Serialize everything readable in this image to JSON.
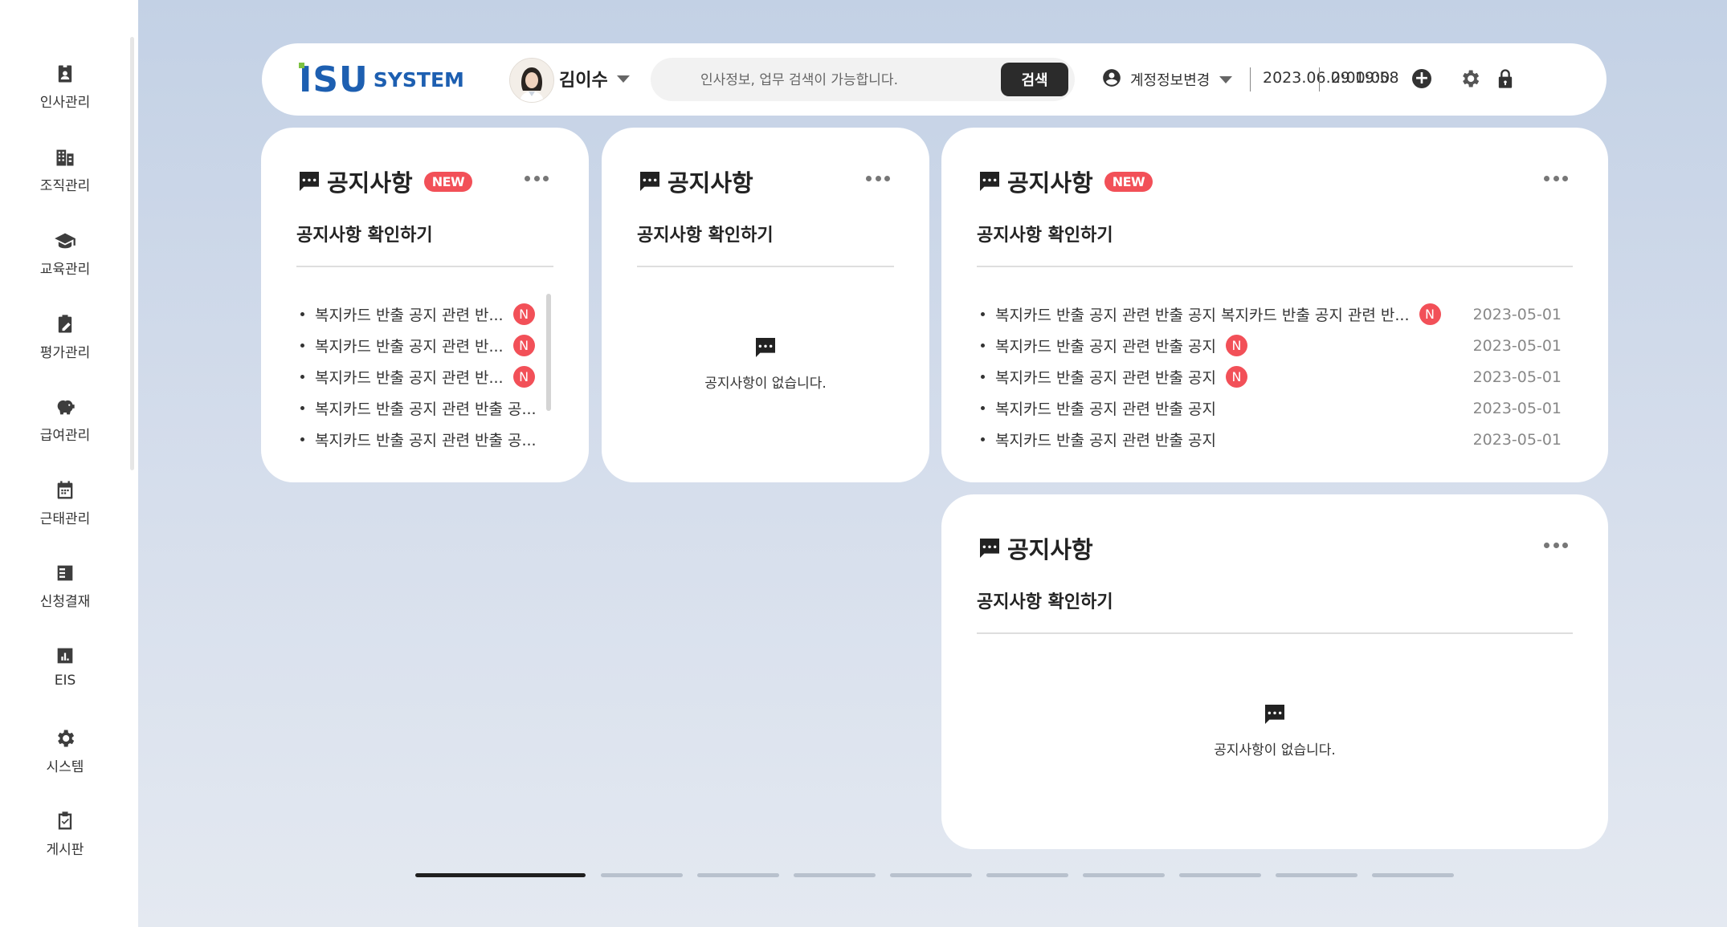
{
  "sidebar": {
    "items": [
      {
        "label": "인사관리",
        "icon": "badge-icon"
      },
      {
        "label": "조직관리",
        "icon": "building-icon"
      },
      {
        "label": "교육관리",
        "icon": "graduation-cap-icon"
      },
      {
        "label": "평가관리",
        "icon": "clipboard-edit-icon"
      },
      {
        "label": "급여관리",
        "icon": "piggy-bank-icon"
      },
      {
        "label": "근태관리",
        "icon": "calendar-icon"
      },
      {
        "label": "신청결재",
        "icon": "checklist-icon"
      },
      {
        "label": "EIS",
        "icon": "bar-chart-icon"
      },
      {
        "label": "시스템",
        "icon": "gear-icon"
      },
      {
        "label": "게시판",
        "icon": "clipboard-check-icon"
      }
    ]
  },
  "header": {
    "logo_mark": "ISU",
    "logo_text": "SYSTEM",
    "user_name": "김이수",
    "search_placeholder": "인사정보, 업무 검색이 가능합니다.",
    "search_button": "검색",
    "account_label": "계정정보변경",
    "datetime": "2023.06.09 19:58",
    "timer": "2:00:00",
    "timer_add": "+"
  },
  "cards": [
    {
      "title": "공지사항",
      "new_badge": "NEW",
      "subtitle": "공지사항 확인하기",
      "items": [
        {
          "text": "복지카드 반출 공지 관련 반...",
          "new": "N"
        },
        {
          "text": "복지카드 반출 공지 관련 반...",
          "new": "N"
        },
        {
          "text": "복지카드 반출 공지 관련 반...",
          "new": "N"
        },
        {
          "text": "복지카드 반출 공지 관련 반출 공..."
        },
        {
          "text": "복지카드 반출 공지 관련 반출 공..."
        }
      ]
    },
    {
      "title": "공지사항",
      "subtitle": "공지사항 확인하기",
      "empty_text": "공지사항이 없습니다."
    },
    {
      "title": "공지사항",
      "new_badge": "NEW",
      "subtitle": "공지사항 확인하기",
      "items": [
        {
          "text": "복지카드 반출 공지 관련 반출 공지 복지카드 반출 공지 관련 반...",
          "new": "N",
          "date": "2023-05-01"
        },
        {
          "text": "복지카드 반출 공지 관련 반출 공지",
          "new": "N",
          "date": "2023-05-01"
        },
        {
          "text": "복지카드 반출 공지 관련 반출 공지",
          "new": "N",
          "date": "2023-05-01"
        },
        {
          "text": "복지카드 반출 공지 관련 반출 공지",
          "date": "2023-05-01"
        },
        {
          "text": "복지카드 반출 공지 관련 반출 공지",
          "date": "2023-05-01"
        }
      ]
    },
    {
      "title": "공지사항",
      "subtitle": "공지사항 확인하기",
      "empty_text": "공지사항이 없습니다."
    }
  ],
  "pagination": {
    "pages": 10,
    "current": 1
  },
  "colors": {
    "accent_red": "#f25058",
    "brand_blue": "#1d5fb1",
    "brand_green": "#7dc242",
    "dark_button": "#2b2b2b"
  }
}
